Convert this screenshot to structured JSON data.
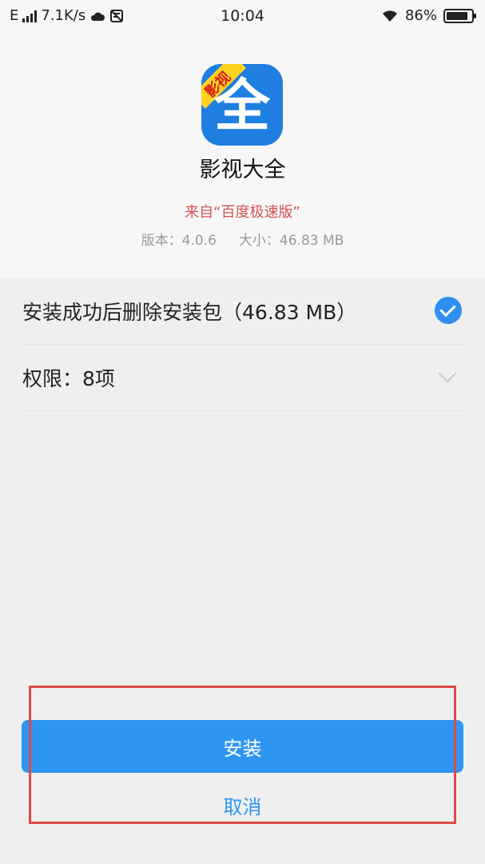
{
  "status_bar": {
    "network": "E",
    "speed": "7.1K/s",
    "time": "10:04",
    "battery": "86%",
    "battery_level": 0.86,
    "icons": [
      "signal-icon",
      "cloud-icon",
      "notification-icon",
      "wifi-icon",
      "battery-icon"
    ]
  },
  "app": {
    "icon_ribbon": "影视",
    "icon_glyph": "全",
    "name": "影视大全",
    "source": "来自“百度极速版”",
    "version": "版本：4.0.6",
    "size": "大小：46.83 MB"
  },
  "options": {
    "delete_package": "安装成功后删除安装包（46.83 MB）",
    "permissions": "权限：8项"
  },
  "actions": {
    "install": "安装",
    "cancel": "取消"
  },
  "colors": {
    "accent": "#2e96f2",
    "source_text": "#d35454",
    "highlight": "#e04848"
  }
}
